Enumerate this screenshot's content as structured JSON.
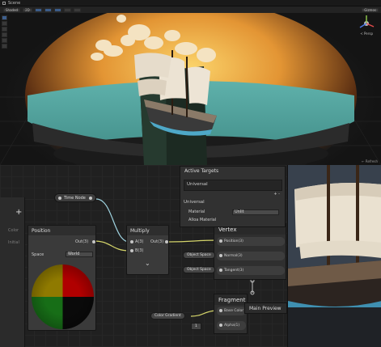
{
  "scene": {
    "tab_title": "Scene",
    "toolbar": {
      "shading_mode": "Shaded",
      "dim_mode": "2D",
      "buttons": [
        "Gizmos"
      ]
    },
    "gizmo_label": "< Persp",
    "status": "← Refresh"
  },
  "graph": {
    "blackboard": {
      "add_label": "+",
      "items": [
        "Color",
        "Initial"
      ]
    },
    "property_node": {
      "label": "Time Node"
    },
    "position_node": {
      "title": "Position",
      "out_label": "Out(3)",
      "space_label": "Space",
      "space_value": "World"
    },
    "multiply_node": {
      "title": "Multiply",
      "in_a": "A(3)",
      "in_b": "B(3)",
      "out_label": "Out(3)",
      "expand": "⌄"
    },
    "vertex": {
      "title": "Vertex",
      "rows": [
        "Position(3)",
        "Normal(3)",
        "Tangent(3)"
      ],
      "slots": [
        "Object Space",
        "Object Space"
      ]
    },
    "fragment": {
      "title": "Fragment",
      "rows": [
        "Base Color",
        "Alpha(1)"
      ],
      "slot_color": "Color Gradient",
      "slot_value": "1"
    },
    "targets": {
      "title": "Active Targets",
      "value": "Universal",
      "buttons": "+  -",
      "section": "Universal",
      "material_label": "Material",
      "material_value": "Unlit",
      "alpha_label": "Alloa Material"
    },
    "main_preview": "Main Preview"
  },
  "colors": {
    "sky_orange": "#d9a23a",
    "water": "#6fb9b1",
    "node_bg": "#3a3a3a",
    "wire": "#9fd3e0"
  }
}
